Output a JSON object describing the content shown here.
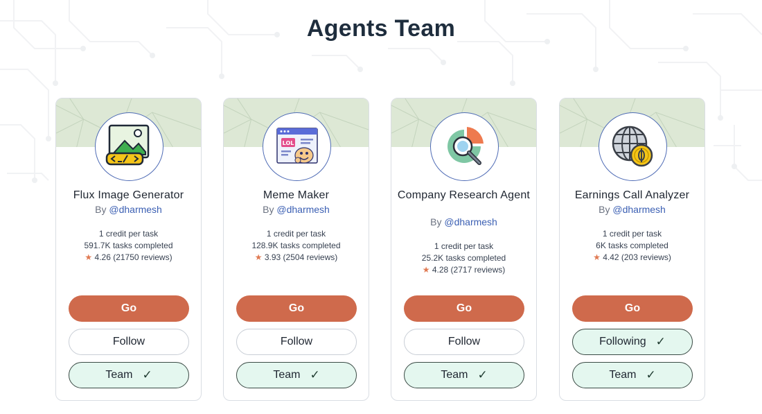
{
  "page": {
    "title": "Agents Team"
  },
  "colors": {
    "go_button": "#cf6a4c",
    "team_button_bg": "#e4f7ef",
    "handle_link": "#3b5fb3",
    "star": "#e07a53"
  },
  "agents": [
    {
      "name": "Flux Image Generator",
      "by_prefix": "By",
      "handle": "@dharmesh",
      "credit": "1 credit per task",
      "tasks": "591.7K tasks completed",
      "star": "★",
      "rating": "4.26 (21750 reviews)",
      "icon": "image-code-icon",
      "go_label": "Go",
      "follow_label": "Follow",
      "following": false,
      "team_label": "Team",
      "team_check": "✓"
    },
    {
      "name": "Meme Maker",
      "by_prefix": "By",
      "handle": "@dharmesh",
      "credit": "1 credit per task",
      "tasks": "128.9K tasks completed",
      "star": "★",
      "rating": "3.93 (2504 reviews)",
      "icon": "meme-browser-icon",
      "go_label": "Go",
      "follow_label": "Follow",
      "following": false,
      "team_label": "Team",
      "team_check": "✓"
    },
    {
      "name": "Company Research Agent",
      "by_prefix": "By",
      "handle": "@dharmesh",
      "credit": "1 credit per task",
      "tasks": "25.2K tasks completed",
      "star": "★",
      "rating": "4.28 (2717 reviews)",
      "icon": "chart-magnifier-icon",
      "go_label": "Go",
      "follow_label": "Follow",
      "following": false,
      "team_label": "Team",
      "team_check": "✓"
    },
    {
      "name": "Earnings Call Analyzer",
      "by_prefix": "By",
      "handle": "@dharmesh",
      "credit": "1 credit per task",
      "tasks": "6K tasks completed",
      "star": "★",
      "rating": "4.42 (203 reviews)",
      "icon": "globe-coin-icon",
      "go_label": "Go",
      "follow_label": "Following",
      "following": true,
      "following_check": "✓",
      "team_label": "Team",
      "team_check": "✓"
    }
  ]
}
